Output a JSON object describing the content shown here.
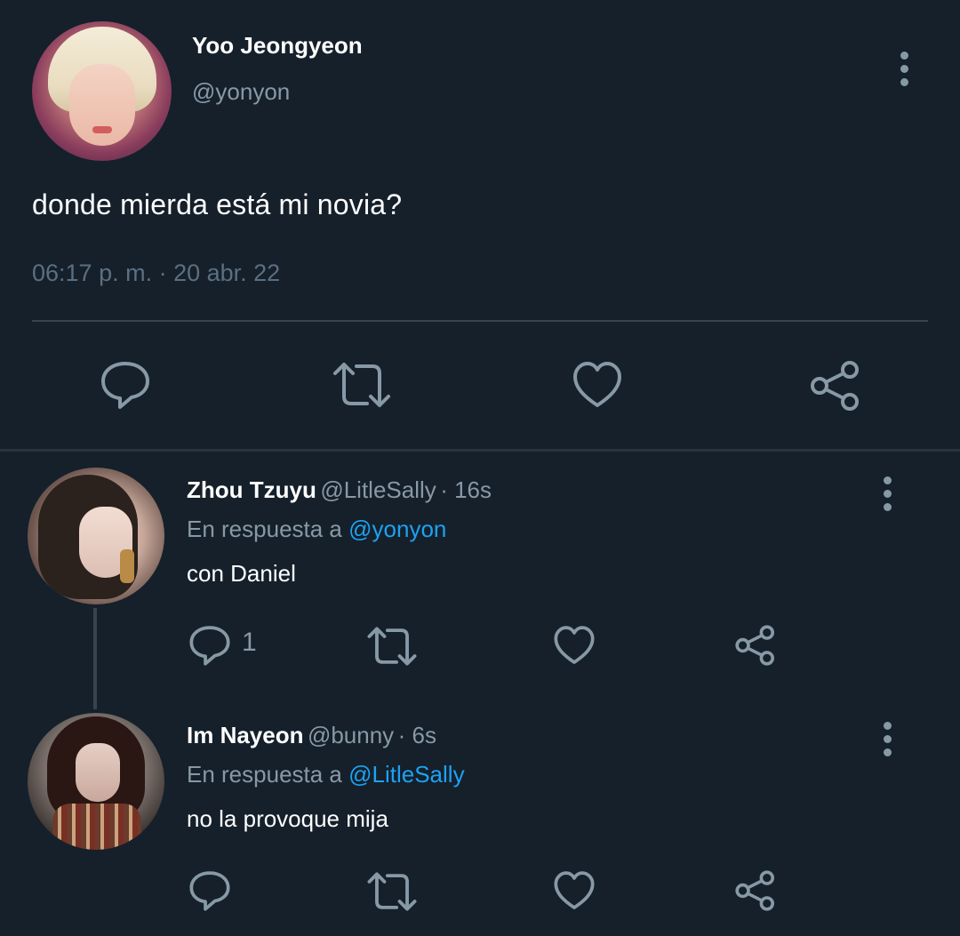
{
  "main_tweet": {
    "name": "Yoo Jeongyeon",
    "handle": "@yonyon",
    "text": "donde mierda está mi novia?",
    "timestamp": "06:17 p. m. · 20 abr. 22",
    "icons": [
      "more-vertical-icon",
      "reply-icon",
      "retweet-icon",
      "like-icon",
      "share-icon"
    ]
  },
  "replies": [
    {
      "name": "Zhou Tzuyu",
      "handle": "@LitleSally",
      "time": "· 16s",
      "reply_prefix": "En respuesta a",
      "reply_to": "@yonyon",
      "text": "con Daniel",
      "reply_count": "1"
    },
    {
      "name": "Im Nayeon",
      "handle": "@bunny",
      "time": "· 6s",
      "reply_prefix": "En respuesta a",
      "reply_to": "@LitleSally",
      "text": "no la provoque mija",
      "reply_count": ""
    }
  ],
  "colors": {
    "background": "#15202b",
    "secondary_text": "#8899a6",
    "mention": "#1da1f2",
    "divider": "#38444d"
  }
}
